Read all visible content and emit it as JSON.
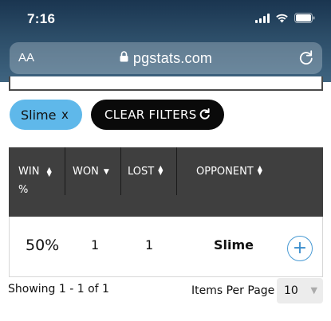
{
  "status_bar": {
    "time": "7:16",
    "icons": [
      "cellular-signal-icon",
      "wifi-icon",
      "battery-icon"
    ]
  },
  "browser": {
    "text_size_label": "AA",
    "url": "pgstats.com",
    "icons": [
      "lock-icon",
      "reload-icon"
    ]
  },
  "filters": {
    "active_chip_label": "Slime",
    "remove_label": "x",
    "clear_label": "CLEAR FILTERS",
    "chip_color": "#5fb8ea",
    "clear_color": "#0a0a0a"
  },
  "table": {
    "header_bg": "#3f3f3f",
    "columns": [
      {
        "label_line1": "WIN",
        "label_line2": "%",
        "sort": "both"
      },
      {
        "label": "WON",
        "sort": "down"
      },
      {
        "label": "LOST",
        "sort": "both"
      },
      {
        "label": "OPPONENT",
        "sort": "both"
      }
    ],
    "rows": [
      {
        "win_pct": "50%",
        "won": "1",
        "lost": "1",
        "opponent": "Slime",
        "action_icon": "plus-icon"
      }
    ]
  },
  "footer": {
    "showing": "Showing 1 - 1 of 1",
    "items_per_page_label": "Items Per Page",
    "items_per_page_value": "10"
  }
}
